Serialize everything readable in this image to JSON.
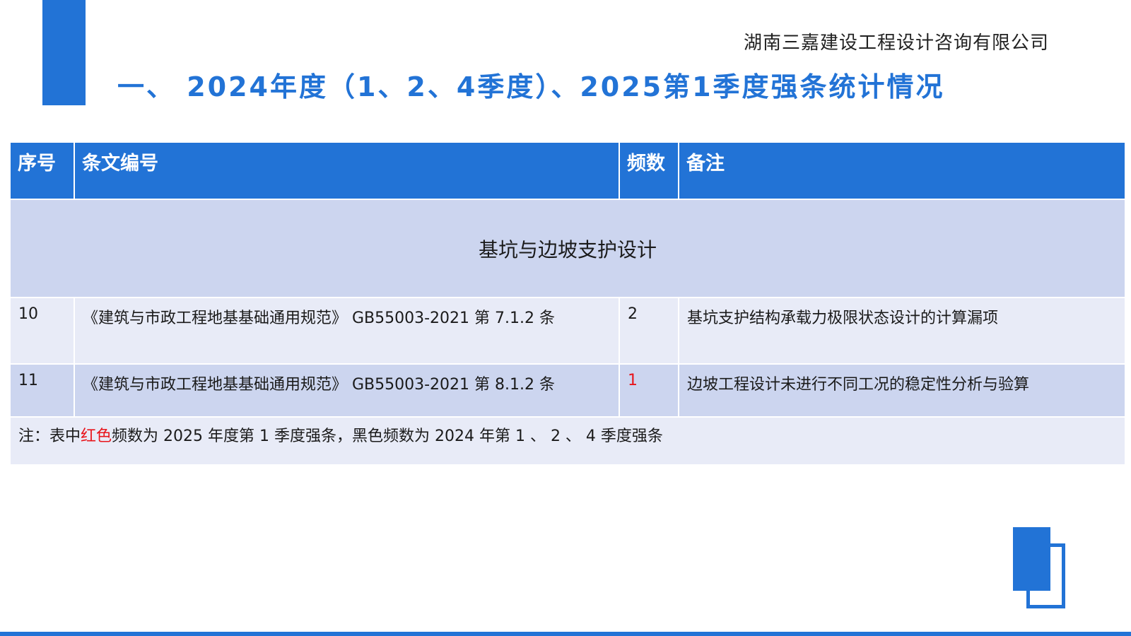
{
  "header": {
    "company": "湖南三嘉建设工程设计咨询有限公司",
    "title": "一、 2024年度（1、2、4季度）、2025第1季度强条统计情况"
  },
  "table": {
    "columns": [
      "序号",
      "条文编号",
      "频数",
      "备注"
    ],
    "section": "基坑与边坡支护设计",
    "rows": [
      {
        "no": "10",
        "clause": "《建筑与市政工程地基基础通用规范》 GB55003-2021 第 7.1.2 条",
        "freq": "2",
        "remark": "基坑支护结构承载力极限状态设计的计算漏项"
      },
      {
        "no": "11",
        "clause": "《建筑与市政工程地基基础通用规范》 GB55003-2021 第 8.1.2 条",
        "freq": "1",
        "remark": "边坡工程设计未进行不同工况的稳定性分析与验算"
      }
    ],
    "note": {
      "prefix": "注：表中",
      "red_word": "红色",
      "suffix": "频数为 2025 年度第 1 季度强条，黑色频数为 2024 年第 1 、 2 、 4 季度强条"
    }
  },
  "colors": {
    "accent": "#2273d6",
    "row_dark": "#ccd5ef",
    "row_light": "#e8ebf7",
    "highlight_red": "#e8141b"
  }
}
